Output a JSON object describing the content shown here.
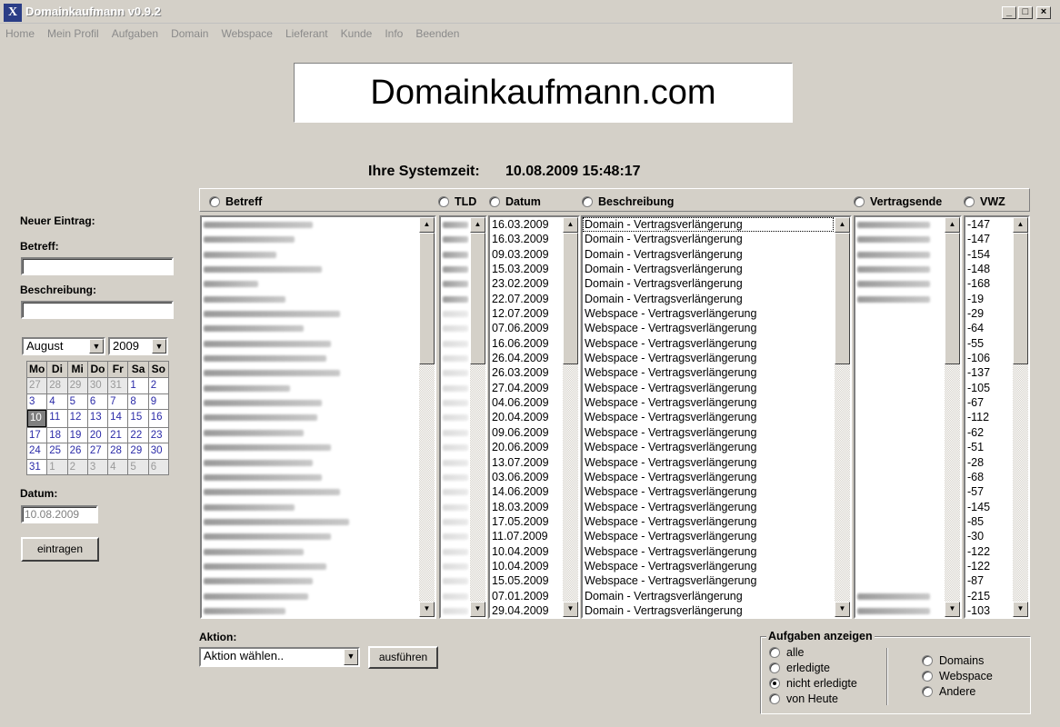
{
  "window": {
    "title": "Domainkaufmann v0.9.2",
    "icon_letter": "X",
    "minimize": "_",
    "maximize": "□",
    "close": "×"
  },
  "menu": [
    "Home",
    "Mein Profil",
    "Aufgaben",
    "Domain",
    "Webspace",
    "Lieferant",
    "Kunde",
    "Info",
    "Beenden"
  ],
  "logo_text": "Domainkaufmann.com",
  "systemzeit": {
    "label": "Ihre Systemzeit:",
    "value": "10.08.2009 15:48:17"
  },
  "form": {
    "new_entry_label": "Neuer Eintrag:",
    "betreff_label": "Betreff:",
    "betreff_value": "",
    "beschreibung_label": "Beschreibung:",
    "beschreibung_value": "",
    "month": "August",
    "year": "2009",
    "datum_label": "Datum:",
    "datum_value": "10.08.2009",
    "submit": "eintragen"
  },
  "calendar": {
    "weekdays": [
      "Mo",
      "Di",
      "Mi",
      "Do",
      "Fr",
      "Sa",
      "So"
    ],
    "weeks": [
      [
        "27",
        "28",
        "29",
        "30",
        "31",
        "1",
        "2"
      ],
      [
        "3",
        "4",
        "5",
        "6",
        "7",
        "8",
        "9"
      ],
      [
        "10",
        "11",
        "12",
        "13",
        "14",
        "15",
        "16"
      ],
      [
        "17",
        "18",
        "19",
        "20",
        "21",
        "22",
        "23"
      ],
      [
        "24",
        "25",
        "26",
        "27",
        "28",
        "29",
        "30"
      ],
      [
        "31",
        "1",
        "2",
        "3",
        "4",
        "5",
        "6"
      ]
    ],
    "today": "10"
  },
  "columns": {
    "betreff": "Betreff",
    "tld": "TLD",
    "datum": "Datum",
    "beschreibung": "Beschreibung",
    "vertragsende": "Vertragsende",
    "vwz": "VWZ"
  },
  "rows": [
    {
      "datum": "16.03.2009",
      "beschreibung": "Domain - Vertragsverlängerung",
      "vwz": "-147"
    },
    {
      "datum": "16.03.2009",
      "beschreibung": "Domain - Vertragsverlängerung",
      "vwz": "-147"
    },
    {
      "datum": "09.03.2009",
      "beschreibung": "Domain - Vertragsverlängerung",
      "vwz": "-154"
    },
    {
      "datum": "15.03.2009",
      "beschreibung": "Domain - Vertragsverlängerung",
      "vwz": "-148"
    },
    {
      "datum": "23.02.2009",
      "beschreibung": "Domain - Vertragsverlängerung",
      "vwz": "-168"
    },
    {
      "datum": "22.07.2009",
      "beschreibung": "Domain - Vertragsverlängerung",
      "vwz": "-19"
    },
    {
      "datum": "12.07.2009",
      "beschreibung": "Webspace - Vertragsverlängerung",
      "vwz": "-29"
    },
    {
      "datum": "07.06.2009",
      "beschreibung": "Webspace - Vertragsverlängerung",
      "vwz": "-64"
    },
    {
      "datum": "16.06.2009",
      "beschreibung": "Webspace - Vertragsverlängerung",
      "vwz": "-55"
    },
    {
      "datum": "26.04.2009",
      "beschreibung": "Webspace - Vertragsverlängerung",
      "vwz": "-106"
    },
    {
      "datum": "26.03.2009",
      "beschreibung": "Webspace - Vertragsverlängerung",
      "vwz": "-137"
    },
    {
      "datum": "27.04.2009",
      "beschreibung": "Webspace - Vertragsverlängerung",
      "vwz": "-105"
    },
    {
      "datum": "04.06.2009",
      "beschreibung": "Webspace - Vertragsverlängerung",
      "vwz": "-67"
    },
    {
      "datum": "20.04.2009",
      "beschreibung": "Webspace - Vertragsverlängerung",
      "vwz": "-112"
    },
    {
      "datum": "09.06.2009",
      "beschreibung": "Webspace - Vertragsverlängerung",
      "vwz": "-62"
    },
    {
      "datum": "20.06.2009",
      "beschreibung": "Webspace - Vertragsverlängerung",
      "vwz": "-51"
    },
    {
      "datum": "13.07.2009",
      "beschreibung": "Webspace - Vertragsverlängerung",
      "vwz": "-28"
    },
    {
      "datum": "03.06.2009",
      "beschreibung": "Webspace - Vertragsverlängerung",
      "vwz": "-68"
    },
    {
      "datum": "14.06.2009",
      "beschreibung": "Webspace - Vertragsverlängerung",
      "vwz": "-57"
    },
    {
      "datum": "18.03.2009",
      "beschreibung": "Webspace - Vertragsverlängerung",
      "vwz": "-145"
    },
    {
      "datum": "17.05.2009",
      "beschreibung": "Webspace - Vertragsverlängerung",
      "vwz": "-85"
    },
    {
      "datum": "11.07.2009",
      "beschreibung": "Webspace - Vertragsverlängerung",
      "vwz": "-30"
    },
    {
      "datum": "10.04.2009",
      "beschreibung": "Webspace - Vertragsverlängerung",
      "vwz": "-122"
    },
    {
      "datum": "10.04.2009",
      "beschreibung": "Webspace - Vertragsverlängerung",
      "vwz": "-122"
    },
    {
      "datum": "15.05.2009",
      "beschreibung": "Webspace - Vertragsverlängerung",
      "vwz": "-87"
    },
    {
      "datum": "07.01.2009",
      "beschreibung": "Domain - Vertragsverlängerung",
      "vwz": "-215"
    },
    {
      "datum": "29.04.2009",
      "beschreibung": "Domain - Vertragsverlängerung",
      "vwz": "-103"
    }
  ],
  "aktion": {
    "label": "Aktion:",
    "selected": "Aktion wählen..",
    "button": "ausführen"
  },
  "aufgaben": {
    "title": "Aufgaben anzeigen",
    "status_options": [
      {
        "label": "alle",
        "checked": false
      },
      {
        "label": "erledigte",
        "checked": false
      },
      {
        "label": "nicht erledigte",
        "checked": true
      },
      {
        "label": "von Heute",
        "checked": false
      }
    ],
    "type_options": [
      {
        "label": "Domains",
        "checked": false
      },
      {
        "label": "Webspace",
        "checked": false
      },
      {
        "label": "Andere",
        "checked": false
      }
    ]
  },
  "icons": {
    "scroll_up": "▲",
    "scroll_down": "▼",
    "dropdown": "▼"
  },
  "colors": {
    "window_bg": "#d4d0c8",
    "calendar_link": "#2a2aa8",
    "menu_disabled": "#8a8a8a"
  }
}
